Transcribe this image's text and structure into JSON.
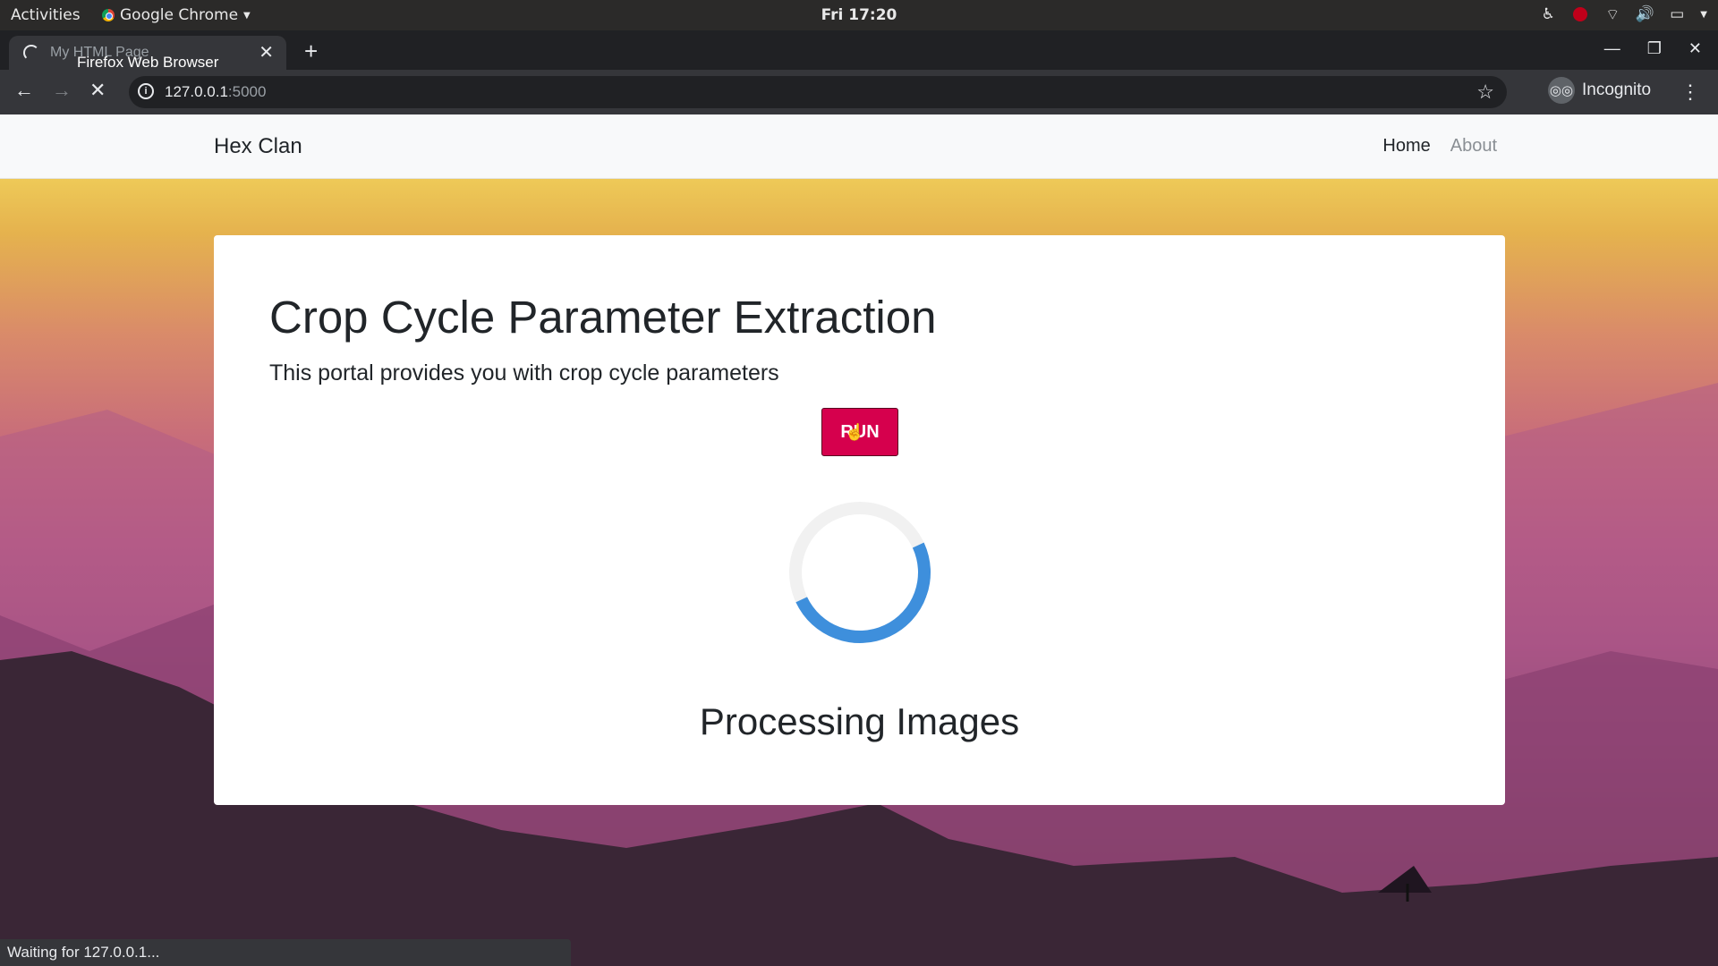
{
  "os_bar": {
    "activities": "Activities",
    "app_name": "Google Chrome",
    "clock": "Fri 17:20"
  },
  "browser": {
    "tab_title": "My HTML Page",
    "tab_tooltip": "Firefox Web Browser",
    "url_host": "127.0.0.1",
    "url_port": ":5000",
    "profile_label": "Incognito",
    "status_text": "Waiting for 127.0.0.1..."
  },
  "site": {
    "brand": "Hex Clan",
    "nav": [
      {
        "label": "Home",
        "active": true
      },
      {
        "label": "About",
        "active": false
      }
    ]
  },
  "main": {
    "heading": "Crop Cycle Parameter Extraction",
    "subtitle": "This portal provides you with crop cycle parameters",
    "run_label": "RUN",
    "processing_text": "Processing Images"
  },
  "colors": {
    "run_button": "#d6004d",
    "spinner_accent": "#3e8fdc"
  },
  "icons": [
    "search-icon",
    "close-icon",
    "plus-icon",
    "back-arrow-icon",
    "forward-arrow-icon",
    "stop-icon",
    "info-icon",
    "star-icon",
    "incognito-icon",
    "kebab-menu-icon"
  ]
}
